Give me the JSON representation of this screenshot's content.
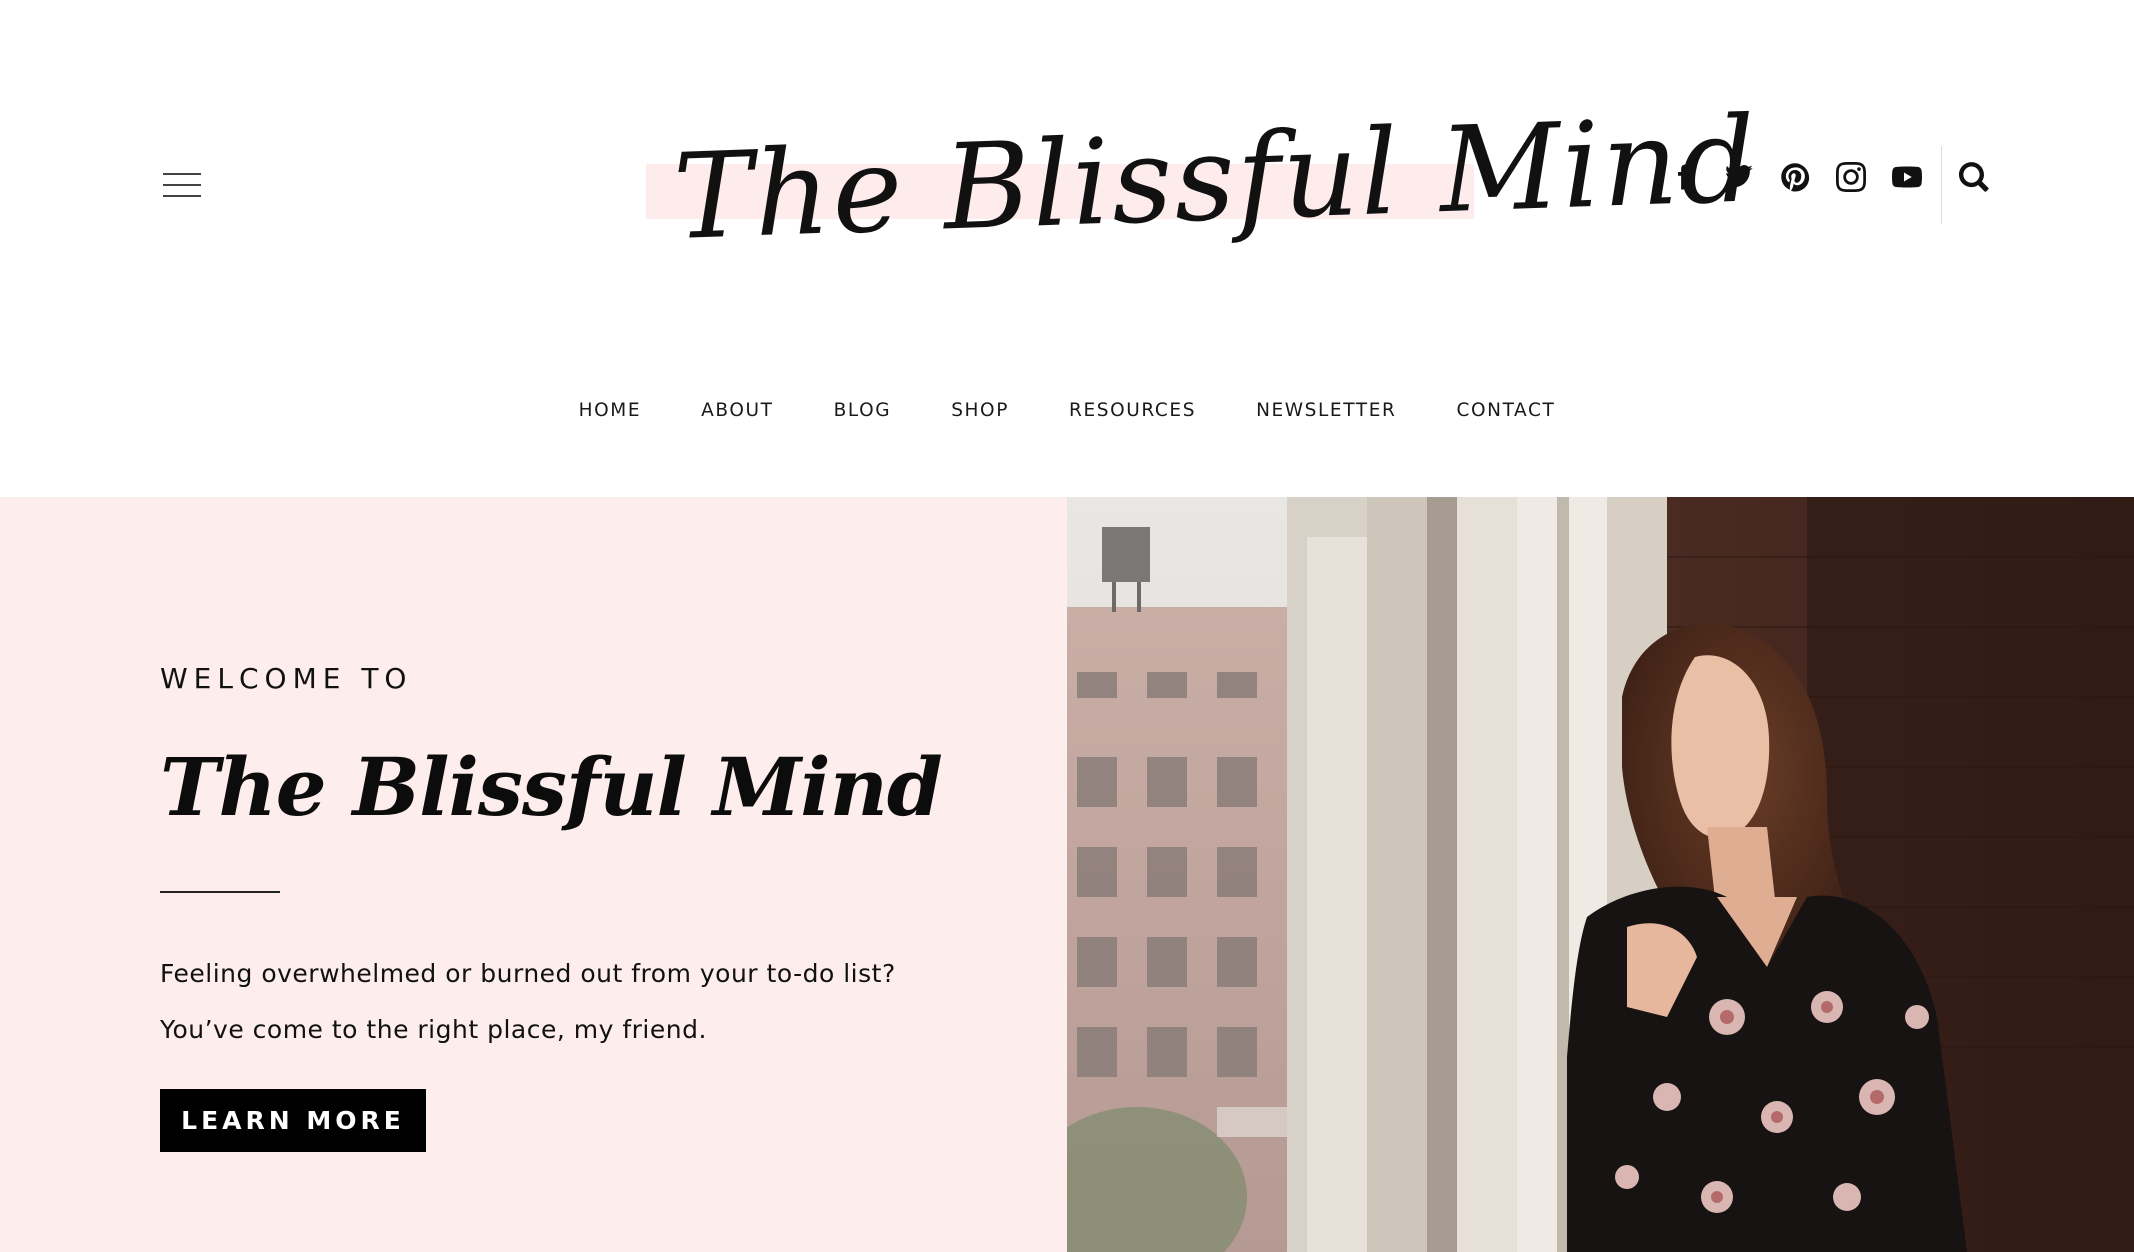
{
  "site": {
    "logo_text": "The Blissful Mind",
    "colors": {
      "accent_pink": "#fdeeed",
      "logo_highlight": "#fdeceb",
      "button_bg": "#000000",
      "text": "#111111"
    }
  },
  "header": {
    "menu_icon": "hamburger-menu-icon",
    "social_icons": [
      "facebook-icon",
      "twitter-icon",
      "pinterest-icon",
      "instagram-icon",
      "youtube-icon"
    ],
    "search_icon": "search-icon"
  },
  "nav": {
    "items": [
      {
        "label": "HOME"
      },
      {
        "label": "ABOUT"
      },
      {
        "label": "BLOG"
      },
      {
        "label": "SHOP"
      },
      {
        "label": "RESOURCES"
      },
      {
        "label": "NEWSLETTER"
      },
      {
        "label": "CONTACT"
      }
    ]
  },
  "hero": {
    "eyebrow": "WELCOME TO",
    "title": "The Blissful Mind",
    "line1": "Feeling overwhelmed or burned out from your to-do list?",
    "line2": "You’ve come to the right place, my friend.",
    "button_label": "LEARN MORE"
  }
}
